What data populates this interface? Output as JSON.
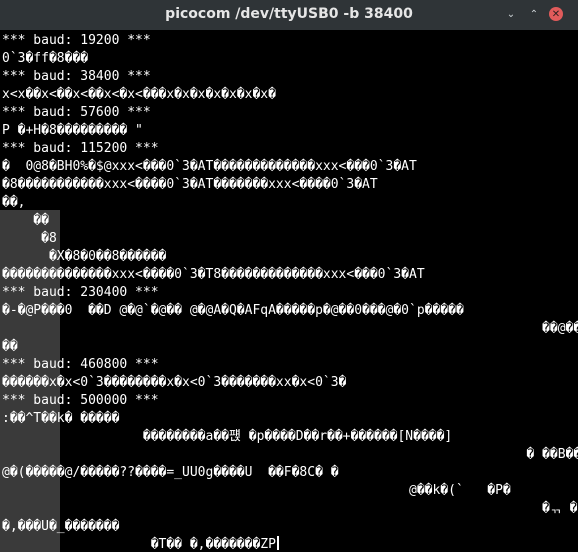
{
  "window": {
    "title": "picocom /dev/ttyUSB0 -b 38400",
    "buttons": {
      "minimize": "⌄",
      "maximize": "⌃",
      "close": "✕"
    }
  },
  "terminal": {
    "lines": [
      "*** baud: 19200 ***",
      "0`3�ff�8���",
      "*** baud: 38400 ***",
      "x<x��x<��x<��x<�x<���x�x�x�x�x�x�x�",
      "*** baud: 57600 ***",
      "P �+H�8��������� \"",
      "*** baud: 115200 ***",
      "�  0@8�BH0%�$@xxx<���0`3�AT�������������xxx<���0`3�AT",
      "�8�����������xxx<����0`3�AT�������xxx<����0`3�AT",
      "��,",
      "    ��",
      "     �8",
      "      �X�8�0��8������",
      "��������������xxx<����0`3�T8�������������xxx<���0`3�AT",
      "*** baud: 230400 ***",
      "�-�@P���0  ��D @�@`�@�� @�@A�Q�AFqA�����p�@��0���@�0`p�����",
      "                                                                     ��@���",
      "��",
      "*** baud: 460800 ***",
      "������x�x<0`3��������x�x<0`3�������xx�x<0`3�",
      "*** baud: 500000 ***",
      ":��^T��k� �����",
      "                  ��������a��퍥 �p����D��r��+������[N����]",
      "                                                                   � ��B����",
      "@�(�����@/�����??����=_UU0g����U  ��F�8C� �",
      "                                                    @��k�(`   �P�",
      "                                                                     �ᆩ � I���",
      "�,���U�_�������",
      "                   �T�� �,�������ZP"
    ]
  }
}
